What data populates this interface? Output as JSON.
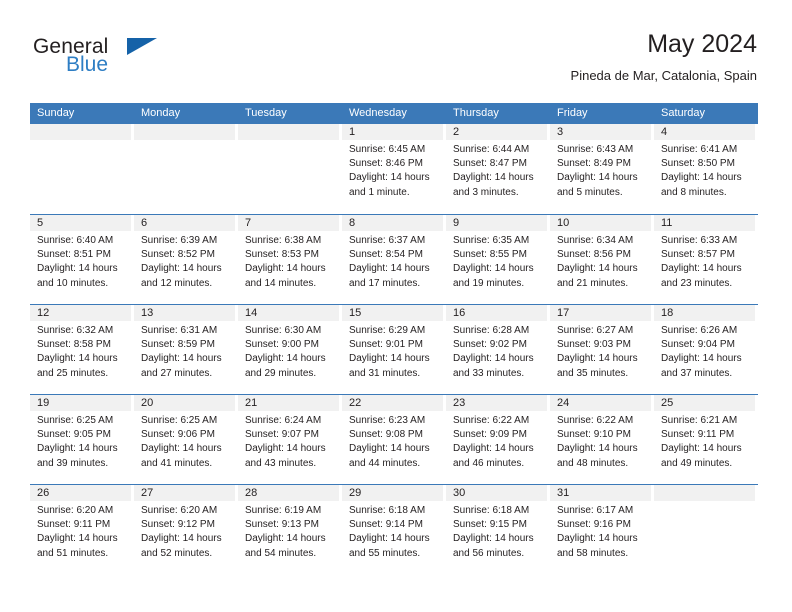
{
  "brand": {
    "name_part1": "General",
    "name_part2": "Blue",
    "flag_icon": "triangle-flag-icon"
  },
  "header": {
    "title": "May 2024",
    "subtitle": "Pineda de Mar, Catalonia, Spain"
  },
  "colors": {
    "header_blue": "#3b79b8",
    "brand_blue": "#2e7ec4",
    "flag_blue": "#1562a8",
    "day_band_gray": "#f1f1f1",
    "text": "#231f20"
  },
  "weekdays": [
    "Sunday",
    "Monday",
    "Tuesday",
    "Wednesday",
    "Thursday",
    "Friday",
    "Saturday"
  ],
  "weeks": [
    [
      {
        "day": "",
        "sunrise": "",
        "sunset": "",
        "daylight_l1": "",
        "daylight_l2": ""
      },
      {
        "day": "",
        "sunrise": "",
        "sunset": "",
        "daylight_l1": "",
        "daylight_l2": ""
      },
      {
        "day": "",
        "sunrise": "",
        "sunset": "",
        "daylight_l1": "",
        "daylight_l2": ""
      },
      {
        "day": "1",
        "sunrise": "Sunrise: 6:45 AM",
        "sunset": "Sunset: 8:46 PM",
        "daylight_l1": "Daylight: 14 hours",
        "daylight_l2": "and 1 minute."
      },
      {
        "day": "2",
        "sunrise": "Sunrise: 6:44 AM",
        "sunset": "Sunset: 8:47 PM",
        "daylight_l1": "Daylight: 14 hours",
        "daylight_l2": "and 3 minutes."
      },
      {
        "day": "3",
        "sunrise": "Sunrise: 6:43 AM",
        "sunset": "Sunset: 8:49 PM",
        "daylight_l1": "Daylight: 14 hours",
        "daylight_l2": "and 5 minutes."
      },
      {
        "day": "4",
        "sunrise": "Sunrise: 6:41 AM",
        "sunset": "Sunset: 8:50 PM",
        "daylight_l1": "Daylight: 14 hours",
        "daylight_l2": "and 8 minutes."
      }
    ],
    [
      {
        "day": "5",
        "sunrise": "Sunrise: 6:40 AM",
        "sunset": "Sunset: 8:51 PM",
        "daylight_l1": "Daylight: 14 hours",
        "daylight_l2": "and 10 minutes."
      },
      {
        "day": "6",
        "sunrise": "Sunrise: 6:39 AM",
        "sunset": "Sunset: 8:52 PM",
        "daylight_l1": "Daylight: 14 hours",
        "daylight_l2": "and 12 minutes."
      },
      {
        "day": "7",
        "sunrise": "Sunrise: 6:38 AM",
        "sunset": "Sunset: 8:53 PM",
        "daylight_l1": "Daylight: 14 hours",
        "daylight_l2": "and 14 minutes."
      },
      {
        "day": "8",
        "sunrise": "Sunrise: 6:37 AM",
        "sunset": "Sunset: 8:54 PM",
        "daylight_l1": "Daylight: 14 hours",
        "daylight_l2": "and 17 minutes."
      },
      {
        "day": "9",
        "sunrise": "Sunrise: 6:35 AM",
        "sunset": "Sunset: 8:55 PM",
        "daylight_l1": "Daylight: 14 hours",
        "daylight_l2": "and 19 minutes."
      },
      {
        "day": "10",
        "sunrise": "Sunrise: 6:34 AM",
        "sunset": "Sunset: 8:56 PM",
        "daylight_l1": "Daylight: 14 hours",
        "daylight_l2": "and 21 minutes."
      },
      {
        "day": "11",
        "sunrise": "Sunrise: 6:33 AM",
        "sunset": "Sunset: 8:57 PM",
        "daylight_l1": "Daylight: 14 hours",
        "daylight_l2": "and 23 minutes."
      }
    ],
    [
      {
        "day": "12",
        "sunrise": "Sunrise: 6:32 AM",
        "sunset": "Sunset: 8:58 PM",
        "daylight_l1": "Daylight: 14 hours",
        "daylight_l2": "and 25 minutes."
      },
      {
        "day": "13",
        "sunrise": "Sunrise: 6:31 AM",
        "sunset": "Sunset: 8:59 PM",
        "daylight_l1": "Daylight: 14 hours",
        "daylight_l2": "and 27 minutes."
      },
      {
        "day": "14",
        "sunrise": "Sunrise: 6:30 AM",
        "sunset": "Sunset: 9:00 PM",
        "daylight_l1": "Daylight: 14 hours",
        "daylight_l2": "and 29 minutes."
      },
      {
        "day": "15",
        "sunrise": "Sunrise: 6:29 AM",
        "sunset": "Sunset: 9:01 PM",
        "daylight_l1": "Daylight: 14 hours",
        "daylight_l2": "and 31 minutes."
      },
      {
        "day": "16",
        "sunrise": "Sunrise: 6:28 AM",
        "sunset": "Sunset: 9:02 PM",
        "daylight_l1": "Daylight: 14 hours",
        "daylight_l2": "and 33 minutes."
      },
      {
        "day": "17",
        "sunrise": "Sunrise: 6:27 AM",
        "sunset": "Sunset: 9:03 PM",
        "daylight_l1": "Daylight: 14 hours",
        "daylight_l2": "and 35 minutes."
      },
      {
        "day": "18",
        "sunrise": "Sunrise: 6:26 AM",
        "sunset": "Sunset: 9:04 PM",
        "daylight_l1": "Daylight: 14 hours",
        "daylight_l2": "and 37 minutes."
      }
    ],
    [
      {
        "day": "19",
        "sunrise": "Sunrise: 6:25 AM",
        "sunset": "Sunset: 9:05 PM",
        "daylight_l1": "Daylight: 14 hours",
        "daylight_l2": "and 39 minutes."
      },
      {
        "day": "20",
        "sunrise": "Sunrise: 6:25 AM",
        "sunset": "Sunset: 9:06 PM",
        "daylight_l1": "Daylight: 14 hours",
        "daylight_l2": "and 41 minutes."
      },
      {
        "day": "21",
        "sunrise": "Sunrise: 6:24 AM",
        "sunset": "Sunset: 9:07 PM",
        "daylight_l1": "Daylight: 14 hours",
        "daylight_l2": "and 43 minutes."
      },
      {
        "day": "22",
        "sunrise": "Sunrise: 6:23 AM",
        "sunset": "Sunset: 9:08 PM",
        "daylight_l1": "Daylight: 14 hours",
        "daylight_l2": "and 44 minutes."
      },
      {
        "day": "23",
        "sunrise": "Sunrise: 6:22 AM",
        "sunset": "Sunset: 9:09 PM",
        "daylight_l1": "Daylight: 14 hours",
        "daylight_l2": "and 46 minutes."
      },
      {
        "day": "24",
        "sunrise": "Sunrise: 6:22 AM",
        "sunset": "Sunset: 9:10 PM",
        "daylight_l1": "Daylight: 14 hours",
        "daylight_l2": "and 48 minutes."
      },
      {
        "day": "25",
        "sunrise": "Sunrise: 6:21 AM",
        "sunset": "Sunset: 9:11 PM",
        "daylight_l1": "Daylight: 14 hours",
        "daylight_l2": "and 49 minutes."
      }
    ],
    [
      {
        "day": "26",
        "sunrise": "Sunrise: 6:20 AM",
        "sunset": "Sunset: 9:11 PM",
        "daylight_l1": "Daylight: 14 hours",
        "daylight_l2": "and 51 minutes."
      },
      {
        "day": "27",
        "sunrise": "Sunrise: 6:20 AM",
        "sunset": "Sunset: 9:12 PM",
        "daylight_l1": "Daylight: 14 hours",
        "daylight_l2": "and 52 minutes."
      },
      {
        "day": "28",
        "sunrise": "Sunrise: 6:19 AM",
        "sunset": "Sunset: 9:13 PM",
        "daylight_l1": "Daylight: 14 hours",
        "daylight_l2": "and 54 minutes."
      },
      {
        "day": "29",
        "sunrise": "Sunrise: 6:18 AM",
        "sunset": "Sunset: 9:14 PM",
        "daylight_l1": "Daylight: 14 hours",
        "daylight_l2": "and 55 minutes."
      },
      {
        "day": "30",
        "sunrise": "Sunrise: 6:18 AM",
        "sunset": "Sunset: 9:15 PM",
        "daylight_l1": "Daylight: 14 hours",
        "daylight_l2": "and 56 minutes."
      },
      {
        "day": "31",
        "sunrise": "Sunrise: 6:17 AM",
        "sunset": "Sunset: 9:16 PM",
        "daylight_l1": "Daylight: 14 hours",
        "daylight_l2": "and 58 minutes."
      },
      {
        "day": "",
        "sunrise": "",
        "sunset": "",
        "daylight_l1": "",
        "daylight_l2": ""
      }
    ]
  ]
}
